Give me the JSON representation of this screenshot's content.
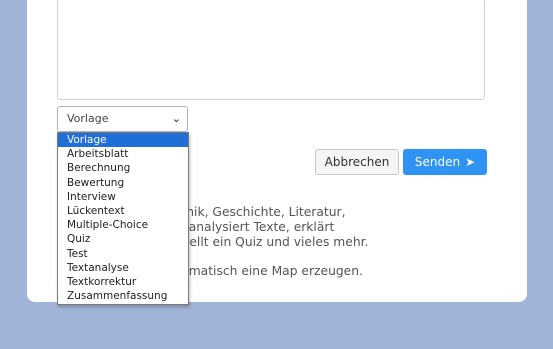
{
  "select": {
    "value": "Vorlage",
    "options": [
      "Vorlage",
      "Arbeitsblatt",
      "Berechnung",
      "Bewertung",
      "Interview",
      "Lückentext",
      "Multiple-Choice",
      "Quiz",
      "Test",
      "Textanalyse",
      "Textkorrektur",
      "Zusammenfassung"
    ]
  },
  "buttons": {
    "cancel": "Abbrechen",
    "send": "Senden"
  },
  "description": {
    "line1": "Wissenschaft, Technik, Geschichte, Literatur,",
    "line2": "zt in jede Sprache, analysiert Texte, erklärt",
    "line3": "ne Geschichte, erstellt ein Quiz und vieles mehr.",
    "line4": "en können Sie automatisch eine Map erzeugen."
  },
  "colors": {
    "page_background": "#a1b3d6",
    "send_button": "#2e93f2",
    "selected_option": "#1f6fd6"
  },
  "icons": {
    "select_chevron": "chevron-down-icon",
    "send": "paper-plane-icon"
  }
}
